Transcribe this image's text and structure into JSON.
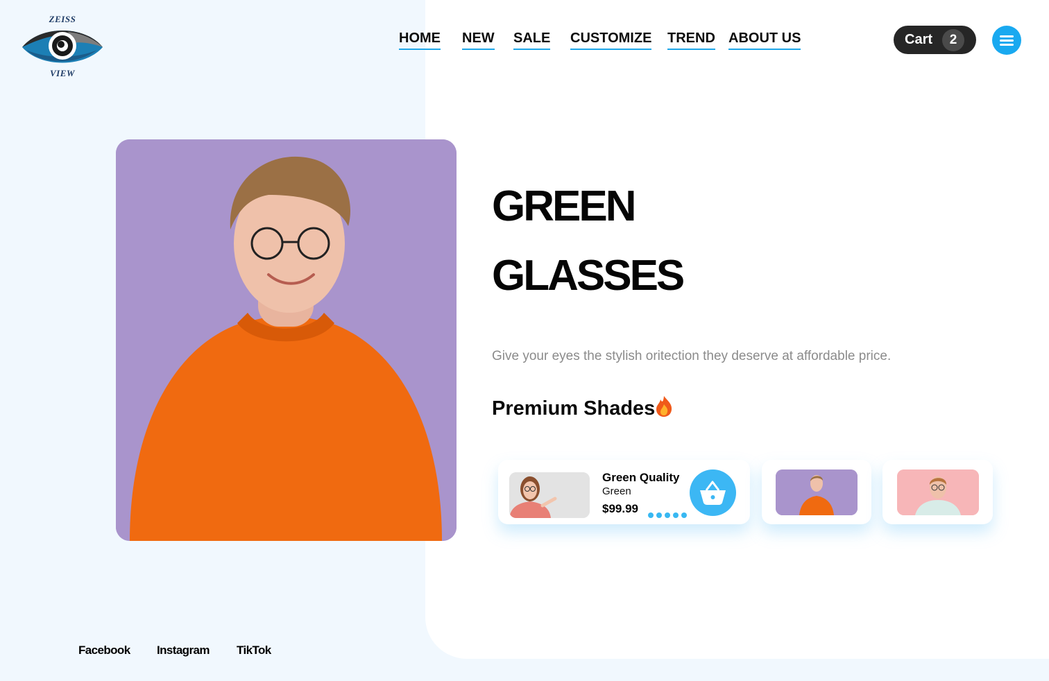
{
  "brand": {
    "logo_top": "ZEISS",
    "logo_bottom": "VIEW",
    "accent": "#1ea6e8"
  },
  "nav": {
    "items": [
      {
        "label": "HOME"
      },
      {
        "label": "NEW"
      },
      {
        "label": "SALE"
      },
      {
        "label": "CUSTOMIZE"
      },
      {
        "label": "TREND"
      },
      {
        "label": "ABOUT US"
      }
    ]
  },
  "cart": {
    "label": "Cart",
    "count": "2"
  },
  "menu": {
    "icon": "hamburger-menu-icon"
  },
  "hero": {
    "image": "man-orange-sweater-glasses-photo",
    "title_line1": "GREEN",
    "title_line2": "GLASSES",
    "subtitle": "Give your eyes the stylish oritection they deserve at affordable price.",
    "section_title": "Premium Shades",
    "section_icon": "fire-emoji-icon"
  },
  "products": {
    "featured": {
      "image": "woman-pointing-glasses-photo",
      "name": "Green Quality",
      "color": "Green",
      "price": "$99.99",
      "rating_dots": 5,
      "action_icon": "shopping-basket-icon"
    },
    "thumbnails": [
      {
        "image": "man-orange-sweater-thumb"
      },
      {
        "image": "man-pink-background-thumb"
      }
    ]
  },
  "footer": {
    "socials": [
      {
        "label": "Facebook"
      },
      {
        "label": "Instagram"
      },
      {
        "label": "TikTok"
      }
    ]
  }
}
